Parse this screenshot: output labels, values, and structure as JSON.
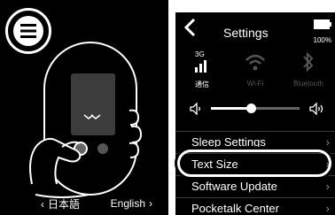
{
  "left": {
    "menu_icon": "menu-list-icon",
    "prev_lang": "日本語",
    "next_lang": "English"
  },
  "right": {
    "title": "Settings",
    "battery_pct": "100%",
    "network": {
      "tag": "3G",
      "label": "通信"
    },
    "wifi": {
      "label": "Wi-Fi"
    },
    "bluetooth": {
      "label": "Bluetooth"
    },
    "volume_level": 0.45,
    "menu": [
      {
        "label": "Sleep Settings"
      },
      {
        "label": "Text Size"
      },
      {
        "label": "Software Update"
      },
      {
        "label": "Pocketalk Center"
      }
    ]
  },
  "colors": {
    "bg": "#000000",
    "fg": "#ffffff",
    "muted": "#666666"
  }
}
